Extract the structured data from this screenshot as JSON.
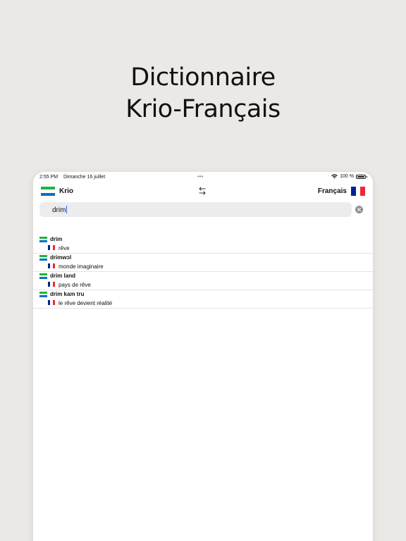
{
  "headline": {
    "line1": "Dictionnaire",
    "line2": "Krio-Français"
  },
  "status": {
    "time": "2:55 PM",
    "date": "Dimanche 16 juillet",
    "dots": "•••",
    "battery": "100 %"
  },
  "topbar": {
    "source_language": "Krio",
    "target_language": "Français"
  },
  "search": {
    "query": "drim"
  },
  "results": [
    {
      "term": "drim",
      "translation": "rêve"
    },
    {
      "term": "drimwɔl",
      "translation": "monde imaginaire"
    },
    {
      "term": "drim land",
      "translation": "pays de rêve"
    },
    {
      "term": "drim kam tru",
      "translation": "le rêve devient réalité"
    }
  ],
  "icons": {
    "swap": "swap-arrows-icon",
    "clear": "clear-icon",
    "source_flag": "sierra-leone-flag-icon",
    "target_flag": "france-flag-icon"
  }
}
